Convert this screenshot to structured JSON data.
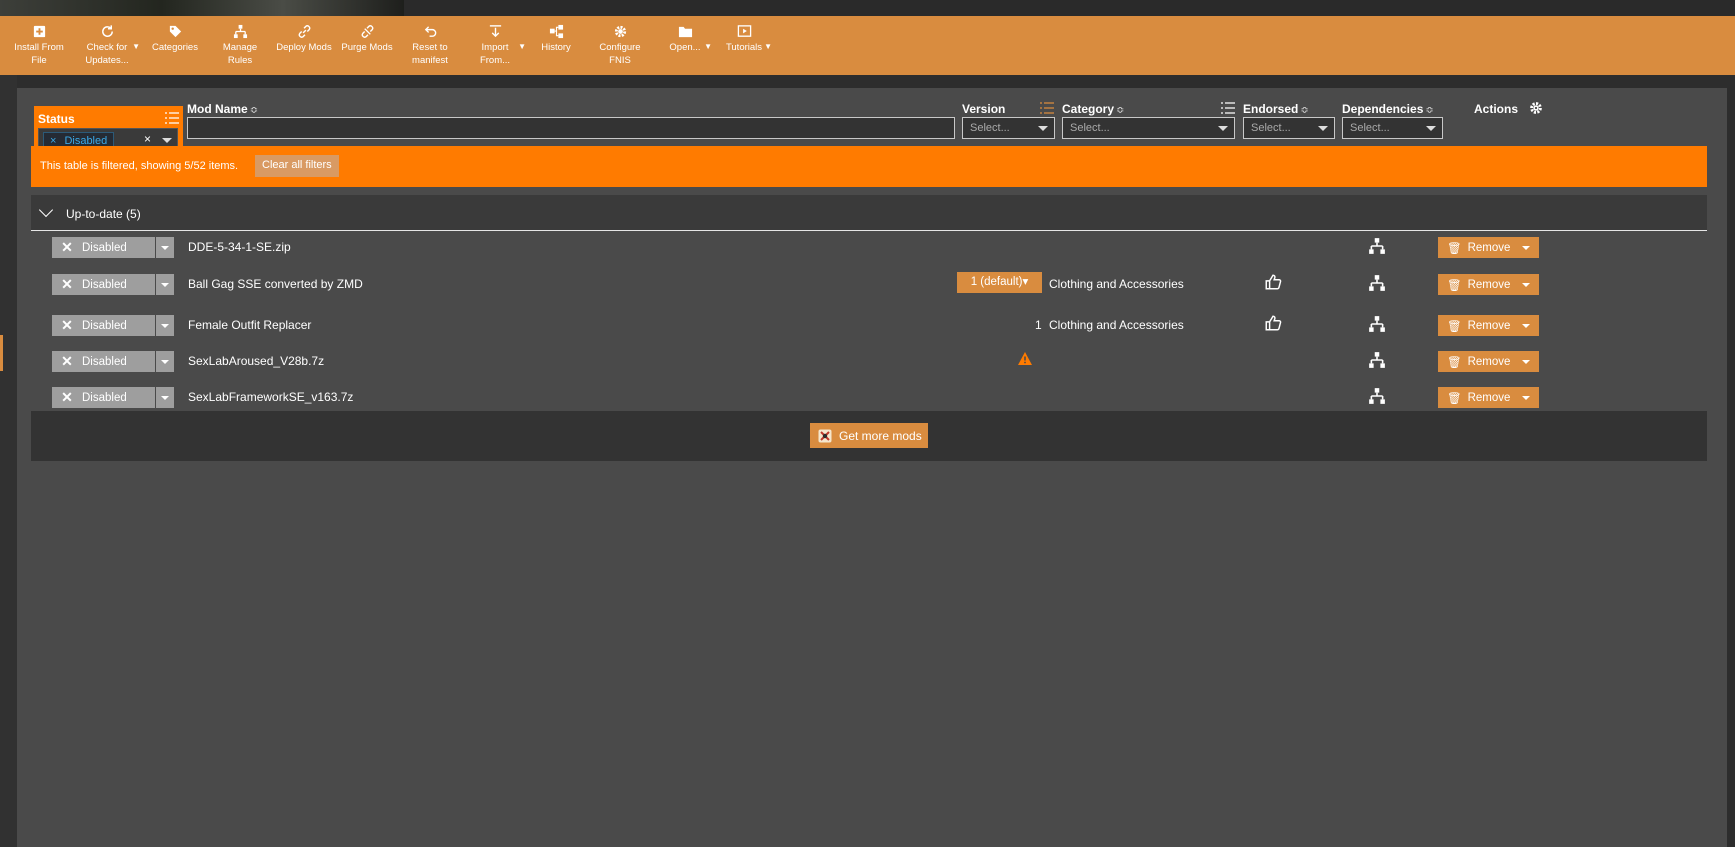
{
  "toolbar": {
    "buttons": [
      {
        "label": "Install From\nFile",
        "icon": "plus-box-icon",
        "caret": false
      },
      {
        "label": "Check for\nUpdates...",
        "icon": "refresh-icon",
        "caret": true
      },
      {
        "label": "Categories",
        "icon": "tag-icon",
        "caret": false
      },
      {
        "label": "Manage\nRules",
        "icon": "rules-icon",
        "caret": false
      },
      {
        "label": "Deploy Mods",
        "icon": "link-icon",
        "caret": false
      },
      {
        "label": "Purge Mods",
        "icon": "unlink-icon",
        "caret": false
      },
      {
        "label": "Reset to\nmanifest",
        "icon": "undo-icon",
        "caret": false
      },
      {
        "label": "Import\nFrom...",
        "icon": "import-icon",
        "caret": true
      },
      {
        "label": "History",
        "icon": "history-icon",
        "caret": false
      },
      {
        "label": "Configure\nFNIS",
        "icon": "gear-icon",
        "caret": false
      },
      {
        "label": "Open...",
        "icon": "folder-icon",
        "caret": true
      },
      {
        "label": "Tutorials",
        "icon": "video-icon",
        "caret": true
      }
    ]
  },
  "columns": {
    "status": "Status",
    "mod_name": "Mod Name",
    "version": "Version",
    "category": "Category",
    "endorsed": "Endorsed",
    "dependencies": "Dependencies",
    "actions": "Actions",
    "sort_glyph": "≎"
  },
  "filters": {
    "status_chip": "Disabled",
    "chip_remove": "×",
    "clear_x": "×",
    "mod_name_value": "",
    "version_placeholder": "Select...",
    "category_placeholder": "Select...",
    "endorsed_placeholder": "Select...",
    "dependencies_placeholder": "Select..."
  },
  "banner": {
    "text": "This table is filtered, showing 5/52 items.",
    "clear_label": "Clear all filters"
  },
  "group": {
    "label": "Up-to-date (5)"
  },
  "rows": [
    {
      "status": "Disabled",
      "name": "DDE-5-34-1-SE.zip",
      "version": "",
      "version_button": "",
      "warning": false,
      "category": "",
      "endorse": false,
      "remove": "Remove"
    },
    {
      "status": "Disabled",
      "name": "Ball Gag SSE converted by ZMD",
      "version": "",
      "version_button": "1 (default)▾",
      "warning": false,
      "category": "Clothing and Accessories",
      "endorse": true,
      "remove": "Remove"
    },
    {
      "status": "Disabled",
      "name": "Female Outfit Replacer",
      "version": "1",
      "version_button": "",
      "warning": false,
      "category": "Clothing and Accessories",
      "endorse": true,
      "remove": "Remove"
    },
    {
      "status": "Disabled",
      "name": "SexLabAroused_V28b.7z",
      "version": "",
      "version_button": "",
      "warning": true,
      "category": "",
      "endorse": false,
      "remove": "Remove"
    },
    {
      "status": "Disabled",
      "name": "SexLabFrameworkSE_v163.7z",
      "version": "",
      "version_button": "",
      "warning": false,
      "category": "",
      "endorse": false,
      "remove": "Remove"
    }
  ],
  "footer": {
    "more_label": "Get more mods"
  },
  "colors": {
    "accent": "#d98c3f",
    "filter_orange": "#ff7b00",
    "panel": "#4a4a4a",
    "disabled": "#9e9e9e"
  }
}
